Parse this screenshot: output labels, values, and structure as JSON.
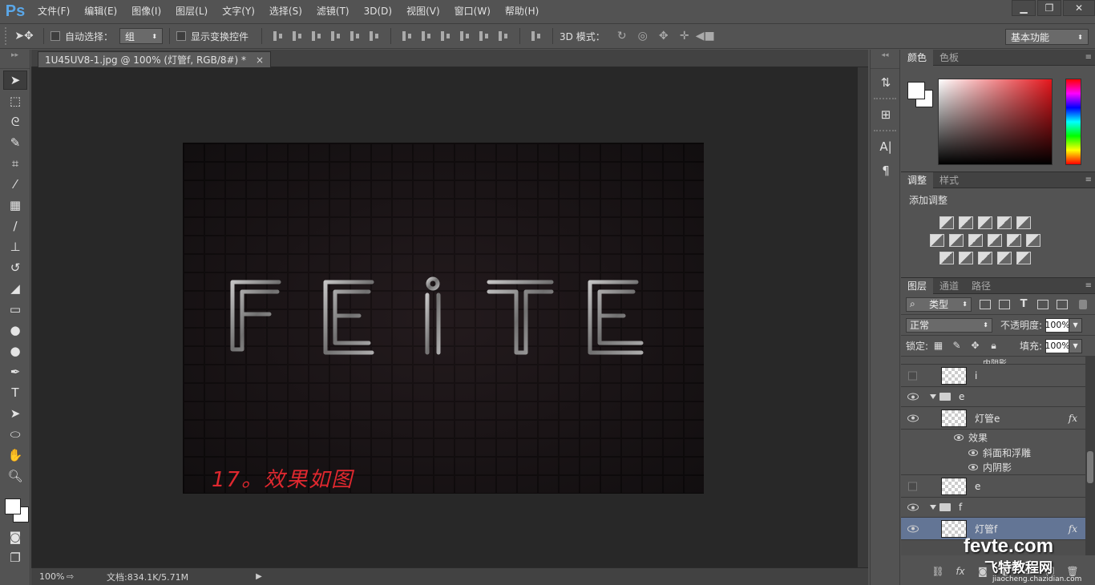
{
  "app": {
    "logo": "Ps",
    "menus": [
      "文件(F)",
      "编辑(E)",
      "图像(I)",
      "图层(L)",
      "文字(Y)",
      "选择(S)",
      "滤镜(T)",
      "3D(D)",
      "视图(V)",
      "窗口(W)",
      "帮助(H)"
    ]
  },
  "options": {
    "auto_select_label": "自动选择：",
    "auto_select_value": "组",
    "transform_label": "显示变换控件",
    "mode3d_label": "3D 模式：",
    "workspace": "基本功能"
  },
  "document": {
    "tab_title": "1U45UV8-1.jpg @ 100% (灯管f, RGB/8#) *",
    "caption": "17。效果如图",
    "artwork_text": "FEITE"
  },
  "status": {
    "zoom": "100%",
    "docsize": "文档:834.1K/5.71M"
  },
  "panels": {
    "color_tabs": [
      "颜色",
      "色板"
    ],
    "adjust_tabs": [
      "调整",
      "样式"
    ],
    "adjust_title": "添加调整",
    "layer_tabs": [
      "图层",
      "通道",
      "路径"
    ],
    "filter_kind": "类型",
    "blend_mode": "正常",
    "opacity_label": "不透明度:",
    "opacity_value": "100%",
    "lock_label": "锁定:",
    "fill_label": "填充:",
    "fill_value": "100%"
  },
  "layers": {
    "partial_top": "内阴影",
    "i_layer": "i",
    "group_e": "e",
    "lamp_e": "灯管e",
    "effects": "效果",
    "bevel": "斜面和浮雕",
    "inner_shadow": "内阴影",
    "e_layer": "e",
    "group_f": "f",
    "lamp_f": "灯管f",
    "fx": "fx"
  },
  "watermark": {
    "main": "fevte.com",
    "cn": "飞特教程网",
    "url": "jiaocheng.chazidian.com"
  },
  "colors": {
    "accent_red": "#e0282f",
    "selection": "#637595",
    "foreground": "#ffffff",
    "background": "#ffffff"
  }
}
